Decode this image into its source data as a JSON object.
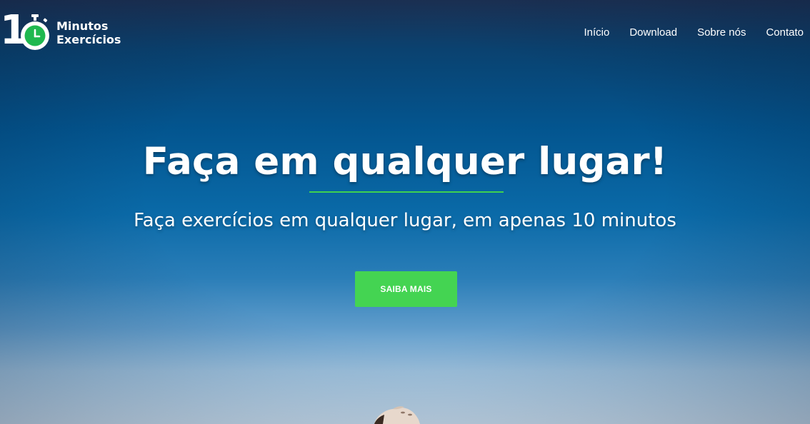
{
  "brand": {
    "logo_number": "1",
    "logo_line1": "Minutos",
    "logo_line2": "Exercícios",
    "accent_color": "#44d452"
  },
  "nav": {
    "items": [
      {
        "label": "Início"
      },
      {
        "label": "Download"
      },
      {
        "label": "Sobre nós"
      },
      {
        "label": "Contato"
      }
    ]
  },
  "hero": {
    "title": "Faça em qualquer lugar!",
    "subtitle": "Faça exercícios em qualquer lugar, em apenas 10 minutos",
    "cta_label": "SAIBA MAIS"
  }
}
